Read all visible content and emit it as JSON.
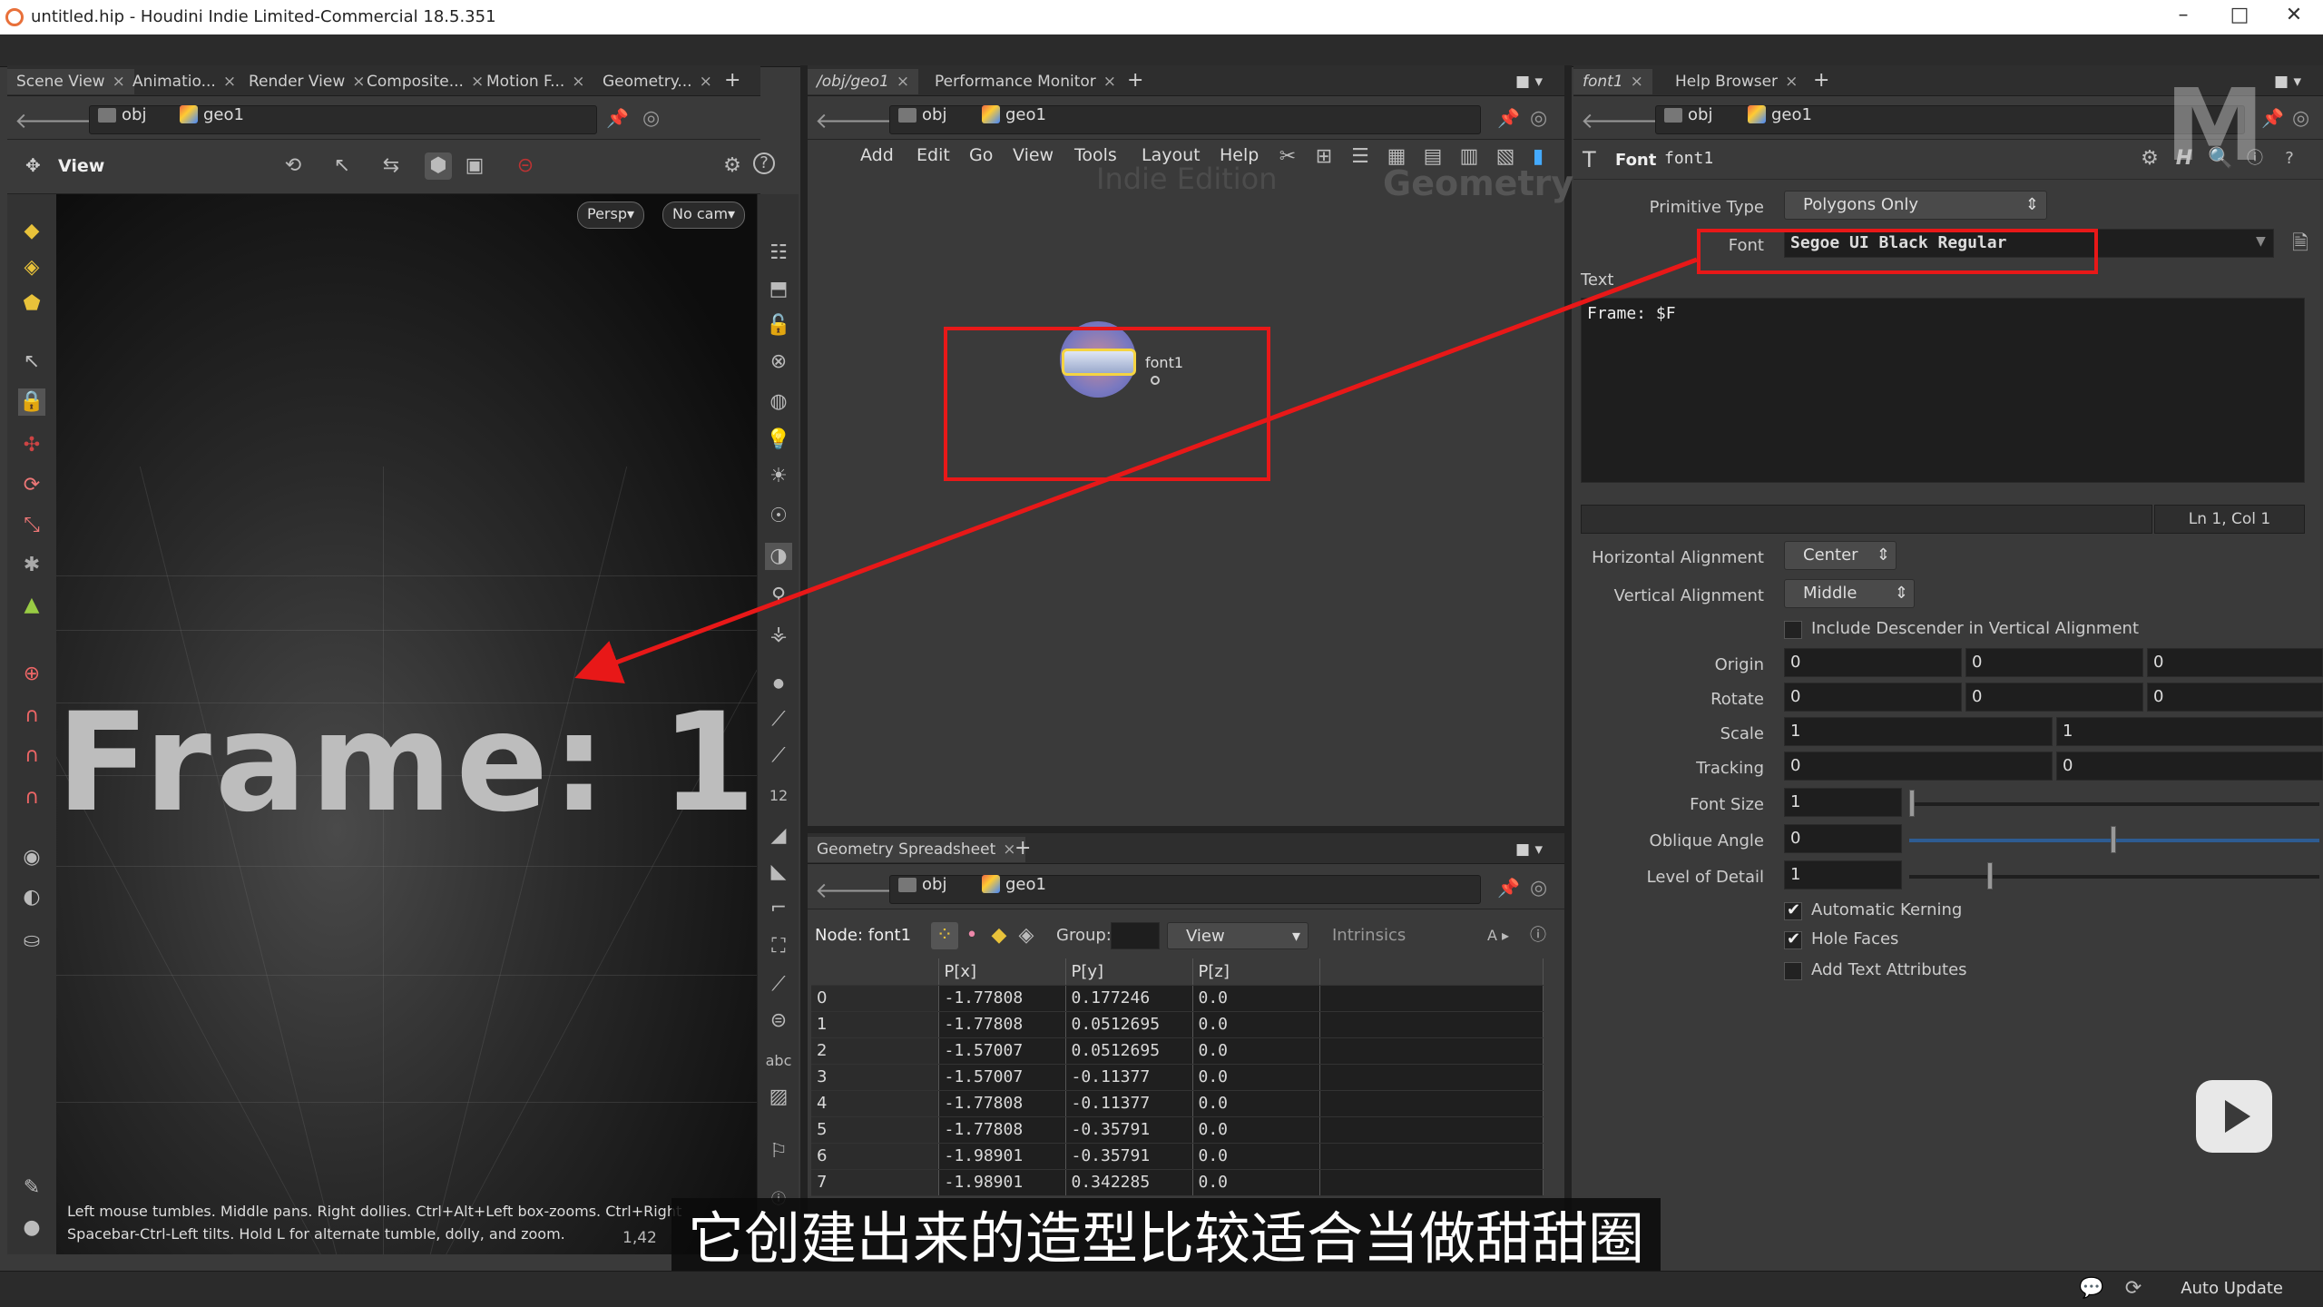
{
  "window": {
    "title": "untitled.hip - Houdini Indie Limited-Commercial 18.5.351",
    "minimize": "–",
    "maximize": "□",
    "close": "✕"
  },
  "left_pane": {
    "tabs": [
      "Scene View",
      "Animatio...",
      "Render View",
      "Composite...",
      "Motion F...",
      "Geometry..."
    ],
    "path": [
      "obj",
      "geo1"
    ],
    "toolbar_label": "View",
    "persp_label": "Persp▾",
    "cam_label": "No cam▾",
    "viewport_text": "Frame: 1",
    "help_line1": "Left mouse tumbles. Middle pans. Right dollies. Ctrl+Alt+Left box-zooms. Ctrl+Right",
    "help_line2": "Spacebar-Ctrl-Left tilts. Hold L for alternate tumble, dolly, and zoom.",
    "coord_readout": "1,42"
  },
  "network_pane": {
    "tabs": [
      "/obj/geo1",
      "Performance Monitor"
    ],
    "path": [
      "obj",
      "geo1"
    ],
    "menu": [
      "Add",
      "Edit",
      "Go",
      "View",
      "Tools",
      "Layout",
      "Help"
    ],
    "watermark_edition": "Indie Edition",
    "watermark_context": "Geometry",
    "node_name": "font1"
  },
  "spreadsheet": {
    "tab": "Geometry Spreadsheet",
    "path": [
      "obj",
      "geo1"
    ],
    "node_label": "Node: font1",
    "group_label": "Group:",
    "view_label": "View",
    "intrinsics_label": "Intrinsics",
    "columns": [
      "",
      "P[x]",
      "P[y]",
      "P[z]"
    ],
    "rows": [
      [
        "0",
        "-1.77808",
        "0.177246",
        "0.0"
      ],
      [
        "1",
        "-1.77808",
        "0.0512695",
        "0.0"
      ],
      [
        "2",
        "-1.57007",
        "0.0512695",
        "0.0"
      ],
      [
        "3",
        "-1.57007",
        "-0.11377",
        "0.0"
      ],
      [
        "4",
        "-1.77808",
        "-0.11377",
        "0.0"
      ],
      [
        "5",
        "-1.77808",
        "-0.35791",
        "0.0"
      ],
      [
        "6",
        "-1.98901",
        "-0.35791",
        "0.0"
      ],
      [
        "7",
        "-1.98901",
        "0.342285",
        "0.0"
      ]
    ]
  },
  "params_pane": {
    "tabs": [
      "font1",
      "Help Browser"
    ],
    "path": [
      "obj",
      "geo1"
    ],
    "node_type": "Font",
    "node_name": "font1",
    "primitive_type_label": "Primitive Type",
    "primitive_type_value": "Polygons Only",
    "font_label": "Font",
    "font_value": "Segoe UI Black Regular",
    "text_label": "Text",
    "text_value": "Frame: $F",
    "cursor_pos": "Ln 1, Col 1",
    "halign_label": "Horizontal Alignment",
    "halign_value": "Center",
    "valign_label": "Vertical Alignment",
    "valign_value": "Middle",
    "descender_label": "Include Descender in Vertical Alignment",
    "origin_label": "Origin",
    "origin": [
      "0",
      "0",
      "0"
    ],
    "rotate_label": "Rotate",
    "rotate": [
      "0",
      "0",
      "0"
    ],
    "scale_label": "Scale",
    "scale": [
      "1",
      "1"
    ],
    "tracking_label": "Tracking",
    "tracking": [
      "0",
      "0"
    ],
    "fontsize_label": "Font Size",
    "fontsize_value": "1",
    "oblique_label": "Oblique Angle",
    "oblique_value": "0",
    "lod_label": "Level of Detail",
    "lod_value": "1",
    "kerning_label": "Automatic Kerning",
    "holes_label": "Hole Faces",
    "attrs_label": "Add Text Attributes"
  },
  "subtitle": "它创建出来的造型比较适合当做甜甜圈",
  "status": {
    "auto_update": "Auto Update"
  },
  "overlay_logo": "M",
  "colors": {
    "accent_red": "#e81818",
    "node_highlight": "#f5d442"
  }
}
